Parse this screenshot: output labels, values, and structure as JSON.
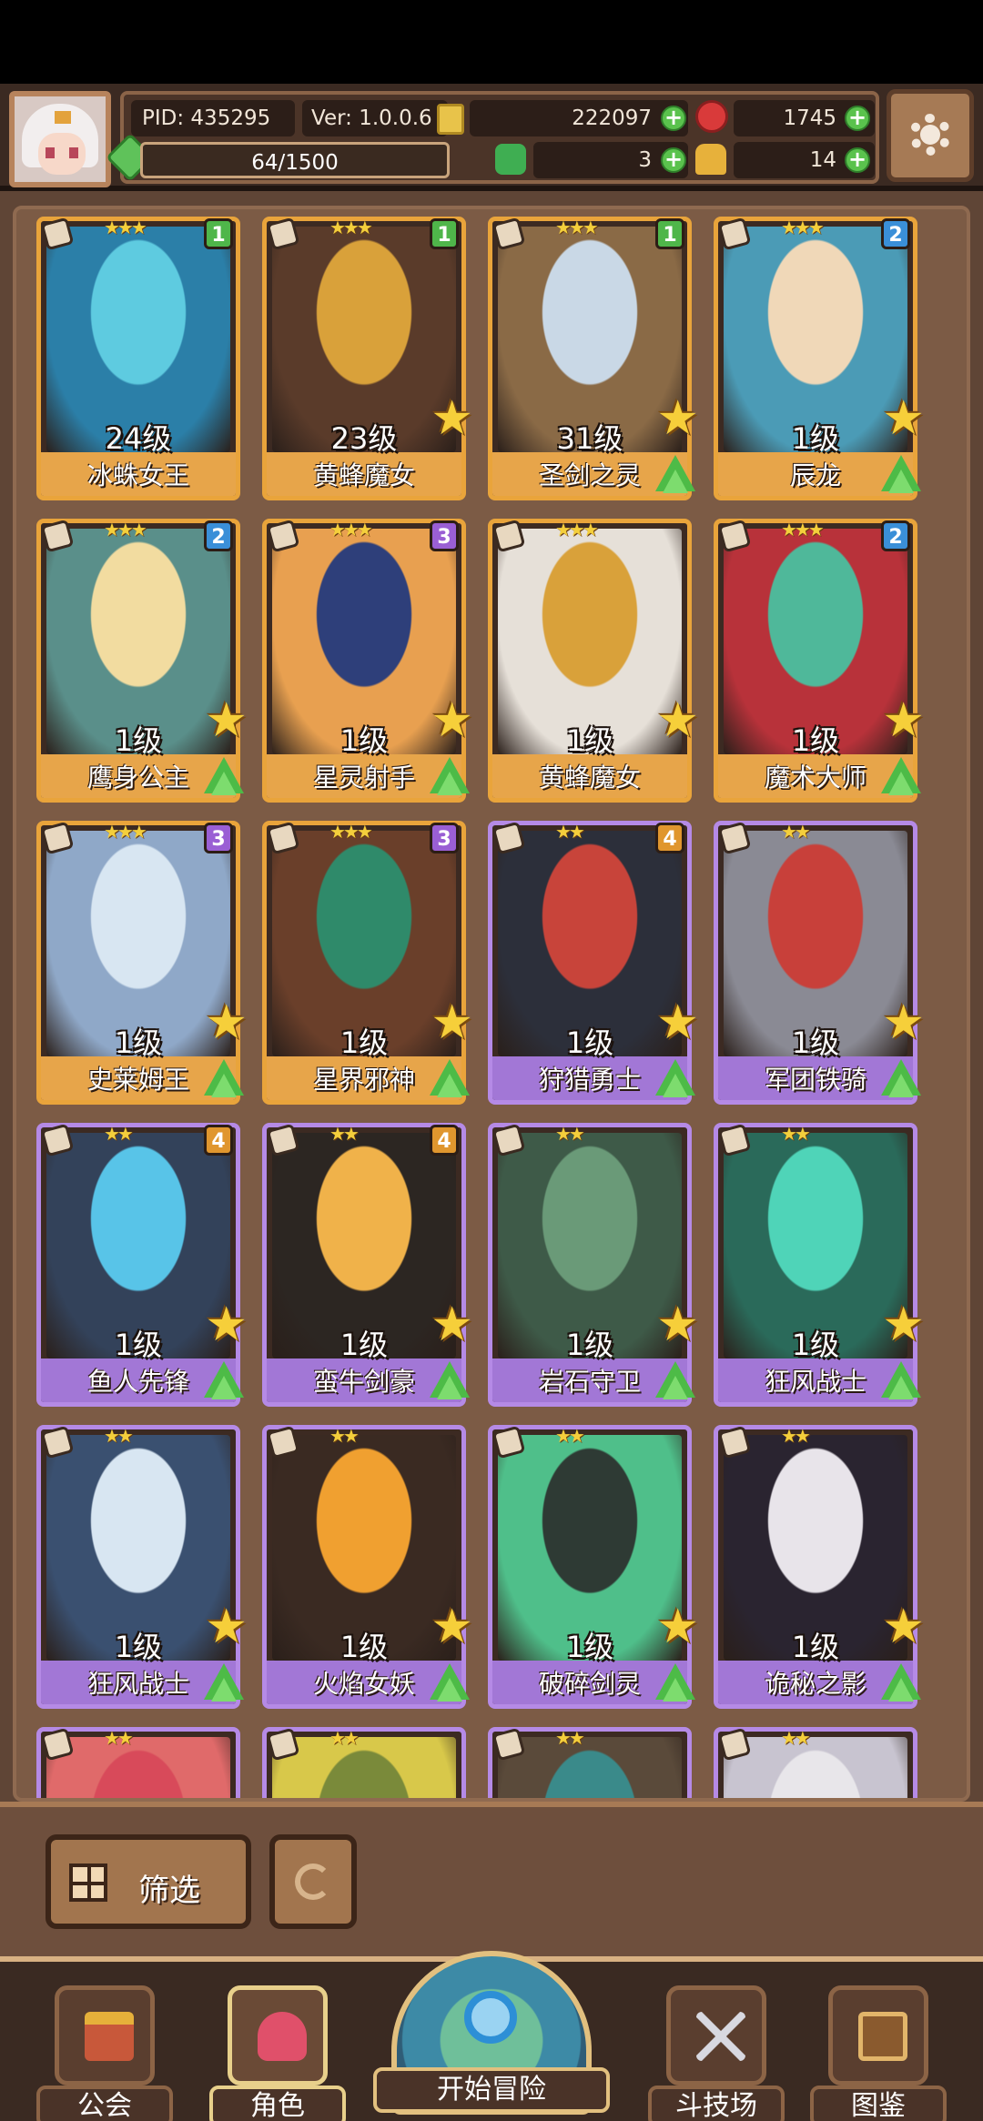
{
  "header": {
    "pid": "PID: 435295",
    "version": "Ver: 1.0.0.6",
    "gold": "222097",
    "gems": "1745",
    "exp": "64/1500",
    "clover": "3",
    "bag": "14",
    "icons": [
      "avatar-portrait",
      "gold-coin-icon",
      "red-gem-icon",
      "green-exp-icon",
      "clover-icon",
      "bag-icon",
      "plus-icon",
      "gear-icon"
    ]
  },
  "cards": [
    {
      "name": "冰蛛女王",
      "level": "24级",
      "stars": "★★★",
      "badge": "1",
      "badge_color": "#4fb64a",
      "rarity": "gold",
      "art": [
        "#5ecbe0",
        "#2b7fa8"
      ],
      "star": false,
      "arrow": false
    },
    {
      "name": "黄蜂魔女",
      "level": "23级",
      "stars": "★★★",
      "badge": "1",
      "badge_color": "#4fb64a",
      "rarity": "gold",
      "art": [
        "#d9a13a",
        "#5a3b2a"
      ],
      "star": true,
      "arrow": false
    },
    {
      "name": "圣剑之灵",
      "level": "31级",
      "stars": "★★★",
      "badge": "1",
      "badge_color": "#4fb64a",
      "rarity": "gold",
      "art": [
        "#c9d8e6",
        "#8a6a46"
      ],
      "star": true,
      "arrow": true
    },
    {
      "name": "辰龙",
      "level": "1级",
      "stars": "★★★",
      "badge": "2",
      "badge_color": "#3a8fd8",
      "rarity": "gold",
      "art": [
        "#f0d8b8",
        "#4b9bb6"
      ],
      "star": true,
      "arrow": true
    },
    {
      "name": "鹰身公主",
      "level": "1级",
      "stars": "★★★",
      "badge": "2",
      "badge_color": "#3a8fd8",
      "rarity": "gold",
      "art": [
        "#f2dca0",
        "#5a8f8a"
      ],
      "star": true,
      "arrow": true
    },
    {
      "name": "星灵射手",
      "level": "1级",
      "stars": "★★★",
      "badge": "3",
      "badge_color": "#9a5fd4",
      "rarity": "gold",
      "art": [
        "#2e3f7a",
        "#e8a050"
      ],
      "star": true,
      "arrow": true
    },
    {
      "name": "黄蜂魔女",
      "level": "1级",
      "stars": "★★★",
      "badge": "",
      "badge_color": "",
      "rarity": "gold",
      "art": [
        "#d9a13a",
        "#e6e0d8"
      ],
      "star": true,
      "arrow": false
    },
    {
      "name": "魔术大师",
      "level": "1级",
      "stars": "★★★",
      "badge": "2",
      "badge_color": "#3a8fd8",
      "rarity": "gold",
      "art": [
        "#4fb89a",
        "#b8323a"
      ],
      "star": true,
      "arrow": true
    },
    {
      "name": "史莱姆王",
      "level": "1级",
      "stars": "★★★",
      "badge": "3",
      "badge_color": "#9a5fd4",
      "rarity": "gold",
      "art": [
        "#d8e6f2",
        "#8fa8c8"
      ],
      "star": true,
      "arrow": true
    },
    {
      "name": "星界邪神",
      "level": "1级",
      "stars": "★★★",
      "badge": "3",
      "badge_color": "#9a5fd4",
      "rarity": "gold",
      "art": [
        "#2f8a6a",
        "#6a3f2a"
      ],
      "star": true,
      "arrow": true
    },
    {
      "name": "狩猎勇士",
      "level": "1级",
      "stars": "★★",
      "badge": "4",
      "badge_color": "#e0962e",
      "rarity": "purple",
      "art": [
        "#c8443a",
        "#2c2f3a"
      ],
      "star": true,
      "arrow": true
    },
    {
      "name": "军团铁骑",
      "level": "1级",
      "stars": "★★",
      "badge": "",
      "badge_color": "",
      "rarity": "purple",
      "art": [
        "#c8403a",
        "#8a8a94"
      ],
      "star": true,
      "arrow": true
    },
    {
      "name": "鱼人先锋",
      "level": "1级",
      "stars": "★★",
      "badge": "4",
      "badge_color": "#e0962e",
      "rarity": "purple",
      "art": [
        "#58c4e8",
        "#33425a"
      ],
      "star": true,
      "arrow": true
    },
    {
      "name": "蛮牛剑豪",
      "level": "1级",
      "stars": "★★",
      "badge": "4",
      "badge_color": "#e0962e",
      "rarity": "purple",
      "art": [
        "#f0b24a",
        "#2c2622"
      ],
      "star": true,
      "arrow": true
    },
    {
      "name": "岩石守卫",
      "level": "1级",
      "stars": "★★",
      "badge": "",
      "badge_color": "",
      "rarity": "purple",
      "art": [
        "#6a9a78",
        "#3e5a48"
      ],
      "star": true,
      "arrow": true
    },
    {
      "name": "狂风战士",
      "level": "1级",
      "stars": "★★",
      "badge": "",
      "badge_color": "",
      "rarity": "purple",
      "art": [
        "#4fd4b8",
        "#2a6a5a"
      ],
      "star": true,
      "arrow": true
    },
    {
      "name": "狂风战士",
      "level": "1级",
      "stars": "★★",
      "badge": "",
      "badge_color": "",
      "rarity": "purple",
      "art": [
        "#d8e6f2",
        "#3a5070"
      ],
      "star": true,
      "arrow": true
    },
    {
      "name": "火焰女妖",
      "level": "1级",
      "stars": "★★",
      "badge": "",
      "badge_color": "",
      "rarity": "purple",
      "art": [
        "#f0a030",
        "#3a2a22"
      ],
      "star": true,
      "arrow": true
    },
    {
      "name": "破碎剑灵",
      "level": "1级",
      "stars": "★★",
      "badge": "",
      "badge_color": "",
      "rarity": "purple",
      "art": [
        "#2e3a34",
        "#4fbf8a"
      ],
      "star": true,
      "arrow": true
    },
    {
      "name": "诡秘之影",
      "level": "1级",
      "stars": "★★",
      "badge": "",
      "badge_color": "",
      "rarity": "purple",
      "art": [
        "#e8e4ea",
        "#2a2430"
      ],
      "star": true,
      "arrow": true
    },
    {
      "name": "",
      "level": "",
      "stars": "★★",
      "badge": "",
      "badge_color": "",
      "rarity": "purple",
      "art": [
        "#d84a5a",
        "#e06a6a"
      ],
      "star": false,
      "arrow": false
    },
    {
      "name": "",
      "level": "",
      "stars": "★★",
      "badge": "",
      "badge_color": "",
      "rarity": "purple",
      "art": [
        "#7a8a3a",
        "#d8c84a"
      ],
      "star": false,
      "arrow": false
    },
    {
      "name": "",
      "level": "",
      "stars": "★★",
      "badge": "",
      "badge_color": "",
      "rarity": "purple",
      "art": [
        "#3a8a8a",
        "#5a4a3a"
      ],
      "star": false,
      "arrow": false
    },
    {
      "name": "",
      "level": "",
      "stars": "★★",
      "badge": "",
      "badge_color": "",
      "rarity": "purple",
      "art": [
        "#e8e6ea",
        "#c8c4d0"
      ],
      "star": false,
      "arrow": false
    }
  ],
  "filter": {
    "filter_label": "筛选"
  },
  "nav": {
    "guild": "公会",
    "character": "角色",
    "adventure": "开始冒险",
    "arena": "斗技场",
    "codex": "图鉴"
  }
}
